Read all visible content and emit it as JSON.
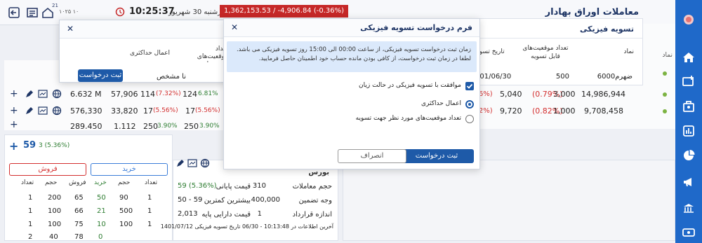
{
  "topbar": {
    "notif_count": "21",
    "date": "چهارشنبه 30 شهریور",
    "time": "10:25:37",
    "time_prefix": "۱۰۲۵ ۱۰",
    "index": "1,362,153.53 / -4,906.84 (-0.36%)",
    "title": "معاملات اوراق بهادار"
  },
  "bg_table": {
    "col_symbol": "نماد",
    "rows": [
      {
        "a": "6.632 M",
        "b": "57,906",
        "c": "114",
        "c_pct": "(7.32%)",
        "d": "124",
        "d_pct": "6.81%",
        "e": "5,040",
        "e_pct": "(0.79%)",
        "f": "3,000",
        "g": "14,986,944"
      },
      {
        "a": "576,330",
        "b": "33,820",
        "c": "17",
        "c_pct": "(5.56%)",
        "d": "17",
        "d_pct": "(5.56%)",
        "e": "9,720",
        "e_pct": "(0.82%)",
        "f": "1,000",
        "g": "9,708,458"
      },
      {
        "a": "289,450",
        "b": "1,112",
        "c": "250",
        "c_pct": "3.90%",
        "d": "250",
        "d_pct": "3.90%",
        "e": "",
        "e_pct": "",
        "f": "",
        "g": ""
      }
    ],
    "pct_left": [
      "(6%)",
      "(2%)"
    ],
    "date_frag": "401/06/30"
  },
  "order_panel": {
    "price": "59",
    "change": "3 (5.36%)",
    "sell_label": "فروش",
    "buy_label": "خرید",
    "depth_headers": [
      "تعداد",
      "حجم",
      "فروش",
      "خرید",
      "حجم",
      "تعداد"
    ],
    "depth_rows": [
      [
        "1",
        "200",
        "65",
        "50",
        "90",
        "1"
      ],
      [
        "1",
        "100",
        "66",
        "21",
        "500",
        "1"
      ],
      [
        "1",
        "100",
        "75",
        "10",
        "100",
        "1"
      ],
      [
        "2",
        "40",
        "78",
        "0",
        "",
        ""
      ]
    ]
  },
  "info_panel": {
    "title": "بورس",
    "rows": [
      {
        "k1": "حجم معاملات",
        "v1": "310",
        "k2": "قیمت پایانی",
        "v2": "59 (5.36%)"
      },
      {
        "k1": "وجه تضمین",
        "v1": "400,000",
        "k2": "بیشترین کمترین",
        "v2": "50 - 59"
      },
      {
        "k1": "اندازه قرارداد",
        "v1": "1",
        "k2": "قیمت دارایی پایه",
        "v2": "2,013"
      }
    ],
    "footer": "آخرین اطلاعات در 10:13:48 - 06/30 تاریخ تسویه فیزیکی 1401/07/12"
  },
  "settlement_panel": {
    "title": "تسویه فیزیکی",
    "headers": [
      "نماد",
      "تعداد موقعیت‌های قابل تسویه",
      "تاریخ تسویه"
    ],
    "row": {
      "symbol": "ضهرم6000",
      "count": "500",
      "date": "1401/06/30"
    }
  },
  "left_modal": {
    "headers": [
      "اعمال حداکثری",
      "تعداد موقعیت‌های مورد نظر جهت تسویه"
    ],
    "cell": "نا مشخص",
    "submit_label": "ثبت درخواست"
  },
  "form_modal": {
    "title": "فرم درخواست تسویه فیزیکی",
    "info": "زمان ثبت درخواست تسویه فیزیکی، از ساعت 00:00 الی 15:00 روز تسویه فیزیکی می باشد. لطفا در زمان ثبت درخواست، از کافی بودن مانده حساب خود اطمینان حاصل فرمایید.",
    "checkbox_label": "موافقت با تسویه فیزیکی در حالت زیان",
    "radio1_label": "اعمال حداکثری",
    "radio2_label": "تعداد موقعیت‌های مورد نظر جهت تسویه",
    "cancel_label": "انصراف",
    "submit_label": "ثبت درخواست"
  },
  "colors": {
    "primary": "#1e5aa8",
    "sidebar": "#1f69c9",
    "sell": "#d32f2f",
    "buy": "#2e7d32",
    "index_bg": "#c62828"
  }
}
